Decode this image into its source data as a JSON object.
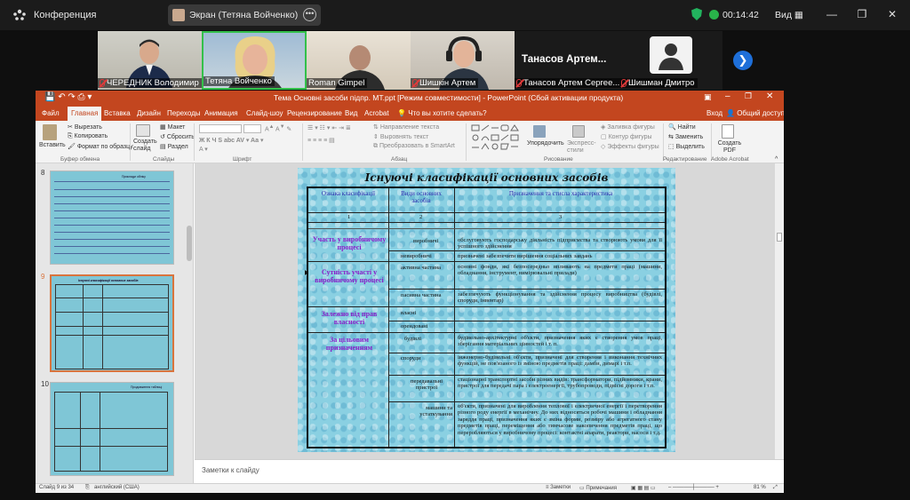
{
  "zoom": {
    "app_title": "Конференция",
    "sharing_label": "Экран (Тетяна Войченко)",
    "timer": "00:14:42",
    "view_label": "Вид",
    "accent": "#1e6fd9"
  },
  "participants": [
    {
      "name": "ЧЕРЕДНИК Володимир",
      "muted": true
    },
    {
      "name": "Тетяна Войченко",
      "muted": false,
      "active": true
    },
    {
      "name": "Roman Gimpel",
      "muted": false
    },
    {
      "name": "Шишкін Артем",
      "muted": true
    },
    {
      "name": "Танасов Артем Сергее...",
      "muted": true,
      "big_name": "Танасов Артем..."
    },
    {
      "name": "Шишман Дмитро",
      "muted": true
    }
  ],
  "ppt": {
    "window_title": "Тема Основні засоби підпр. МТ.ppt [Режим совместимости] - PowerPoint (Сбой активации продукта)",
    "tabs": [
      "Файл",
      "Главная",
      "Вставка",
      "Дизайн",
      "Переходы",
      "Анимация",
      "Слайд-шоу",
      "Рецензирование",
      "Вид",
      "Acrobat",
      "Что вы хотите сделать?"
    ],
    "account": [
      "Вход",
      "Общий доступ"
    ],
    "ribbon": {
      "paste": "Вставить",
      "cut": "Вырезать",
      "copy": "Копировать",
      "format_painter": "Формат по образцу",
      "new_slide": "Создать слайд",
      "layout": "Макет",
      "reset": "Сбросить",
      "section": "Раздел",
      "text_direction": "Направление текста",
      "align_text": "Выровнять текст",
      "smartart": "Преобразовать в SmartArt",
      "arrange": "Упорядочить",
      "quick_styles": "Экспресс-стили",
      "shape_fill": "Заливка фигуры",
      "shape_outline": "Контур фигуры",
      "shape_effects": "Эффекты фигуры",
      "find": "Найти",
      "replace": "Заменить",
      "select": "Выделить",
      "create_pdf": "Создать PDF",
      "groups": [
        "Буфер обмена",
        "Слайды",
        "Шрифт",
        "Абзац",
        "Рисование",
        "Редактирование",
        "Adobe Acrobat"
      ]
    },
    "thumbnails": [
      {
        "num": "8",
        "title": "Приклади обліку"
      },
      {
        "num": "9",
        "title": "Існуючі класифікації основних засобів",
        "selected": true
      },
      {
        "num": "10",
        "title": "Продовження таблиці"
      }
    ],
    "slide": {
      "title": "Існуючі класифікації основних засобів",
      "headers": [
        "Ознака класифікації",
        "Види основних засобів",
        "Призначення та стисла характеристика"
      ],
      "header_nums": [
        "1",
        "2",
        "3"
      ],
      "categories": [
        "Участь у виробничому процесі",
        "Сутність участі у виробничому процесі",
        "Залежно від прав власності",
        "За цільовим призначенням"
      ],
      "rows": [
        {
          "type": "виробничі",
          "desc": "обслуговують господарську діяльність підприємства та створюють умови для її успішного здійснення"
        },
        {
          "type": "невиробничі",
          "desc": "призначені забезпечити вирішення соціальних завдань"
        },
        {
          "type": "активна частина",
          "desc": "основні фонди, які безпосередньо впливають на предмети праці (машини, обладнання, інструмент, вимірювальні прилади)"
        },
        {
          "type": "пасивна частина",
          "desc": "забезпечують функціонування та здійснення процесу виробництва (будівлі, споруди, інвентар)"
        },
        {
          "type": "власні",
          "desc": ""
        },
        {
          "type": "орендовані",
          "desc": ""
        },
        {
          "type": "будівлі",
          "desc": "будівельно-архітектурні об'єкти, призначення яких є створення умов праці, зберігання матеріальних цінностей і т. п."
        },
        {
          "type": "споруди",
          "desc": "інженерно-будівельні об'єкти, призначені для створення і виконання технічних функцій, не пов'язаного із зміною предметів праці: дамби, димарі і т.п."
        },
        {
          "type": "передавальні пристрої",
          "desc": "стаціонарні транспортні засоби різних видів: трансформатори, підйомники, крани, пристрої для передачі пара і електроенергії, трубопроводи, підвісні дороги і т.п."
        },
        {
          "type": "машини та устаткування",
          "desc": "об'єкти, призначені для вироблення теплової і електричної енергії і перетворення різного роду енергії в механічну. До них відносяться робочі машини і обладнання заряддя праці, призначення яких є зміна форми, розміру або агрегатного стану предметів праці, переміщення або тимчасове накопичення предметів праці, що переробляються у виробничому процесі: контактні апарати, реактори, насоси і т.д."
        }
      ]
    },
    "notes_placeholder": "Заметки к слайду",
    "status": {
      "slide_pos": "Слайд 9 из 34",
      "language": "английский (США)",
      "notes": "Заметки",
      "comments": "Примечания",
      "zoom": "81 %"
    }
  }
}
